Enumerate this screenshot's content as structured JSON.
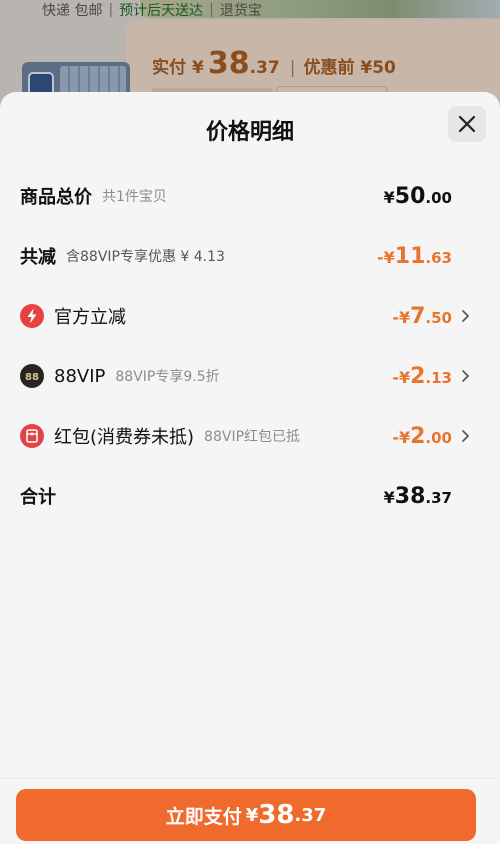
{
  "background": {
    "shipping": [
      "快递 包邮",
      "预计后天送达",
      "退货宝"
    ],
    "price": {
      "label": "实付",
      "currency": "¥",
      "integer": "38",
      "decimal": ".37",
      "separator": "|",
      "before_label": "优惠前 ¥50"
    }
  },
  "sheet": {
    "title": "价格明细",
    "close_icon": "close-icon",
    "rows": {
      "total": {
        "label": "商品总价",
        "sub": "共1件宝贝",
        "currency": "¥",
        "integer": "50",
        "decimal": ".00"
      },
      "reduce": {
        "label": "共减",
        "sub": "含88VIP专享优惠 ¥ 4.13",
        "currency": "-¥",
        "integer": "11",
        "decimal": ".63"
      },
      "official": {
        "icon": "lightning-icon",
        "label": "官方立减",
        "currency": "-¥",
        "integer": "7",
        "decimal": ".50"
      },
      "vip": {
        "icon": "88vip-icon",
        "icon_text": "88",
        "label": "88VIP",
        "sub": "88VIP专享9.5折",
        "currency": "-¥",
        "integer": "2",
        "decimal": ".13"
      },
      "redpacket": {
        "icon": "red-packet-icon",
        "label": "红包(消费券未抵)",
        "sub": "88VIP红包已抵",
        "currency": "-¥",
        "integer": "2",
        "decimal": ".00"
      },
      "sum": {
        "label": "合计",
        "currency": "¥",
        "integer": "38",
        "decimal": ".37"
      }
    }
  },
  "footer": {
    "pay_label": "立即支付",
    "currency": "¥",
    "integer": "38",
    "decimal": ".37"
  },
  "colors": {
    "accent": "#ef6a2c",
    "discount": "#e8752e",
    "icon_red": "#e54343"
  }
}
